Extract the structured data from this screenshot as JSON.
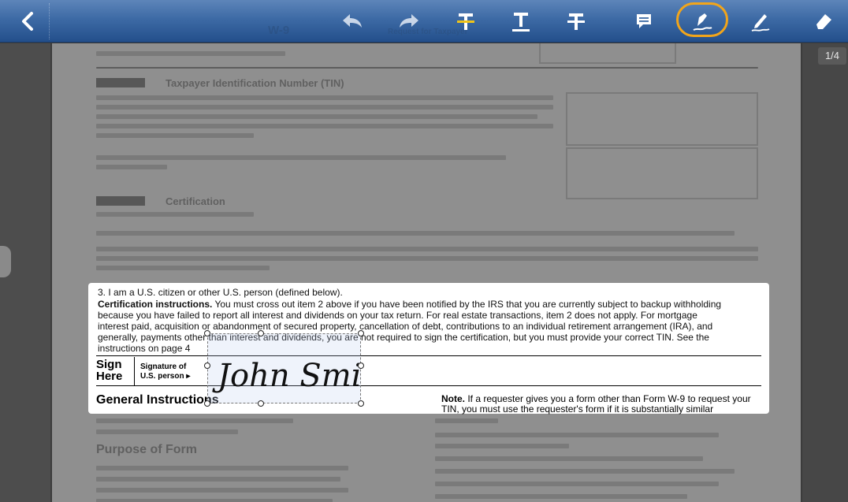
{
  "toolbar": {
    "icons": [
      "back-arrow-icon",
      "undo-icon",
      "redo-icon",
      "strikethrough-text-icon",
      "underline-text-icon",
      "strikeout-text-icon",
      "comment-icon",
      "signature-pen-icon",
      "freehand-pencil-icon",
      "eraser-icon"
    ],
    "accent": "#f2a51a",
    "title_blurred": "W-9",
    "request_blurred": "Request for Taxpayer"
  },
  "page_indicator": "1/4",
  "document": {
    "part1_title": "Taxpayer Identification Number (TIN)",
    "part2_title": "Certification",
    "item3": "3. I am a U.S. citizen or other U.S. person (defined below).",
    "cert_bold": "Certification instructions.",
    "cert_line1": " You must cross out item 2 above if you have been notified by the IRS that you are currently subject to backup withholding",
    "cert_line2": "because you have failed to report all interest and dividends on your tax return. For real estate transactions, item 2 does not apply. For mortgage",
    "cert_line3": "interest paid, acquisition or abandonment of secured property, cancellation of debt, contributions to an individual retirement arrangement (IRA), and",
    "cert_line4": "generally, payments other than interest and dividends, you are not required to sign the certification, but you must provide your correct TIN. See the",
    "cert_line5": "instructions on page 4",
    "sign_here": "Sign\nHere",
    "sig_label_line1": "Signature of",
    "sig_label_line2": "U.S. person ▸",
    "general_instructions": "General Instructions",
    "note_bold": "Note.",
    "note_text": " If a requester gives you a form other than Form W-9 to request your TIN, you must use the requester's form if it is substantially similar",
    "signature": "John Smith",
    "purpose_blurred": "Purpose of Form"
  }
}
